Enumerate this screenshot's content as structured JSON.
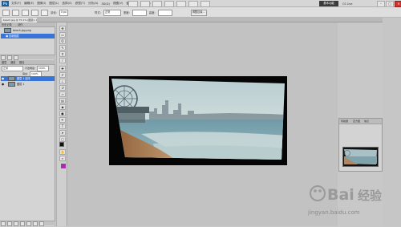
{
  "menubar": {
    "logo": "Ps",
    "items": [
      "文件(F)",
      "编辑(E)",
      "图像(I)",
      "图层(L)",
      "选择(S)",
      "滤镜(T)",
      "分析(A)",
      "3D(D)",
      "视图(V)",
      "窗口(W)",
      "帮助(H)"
    ],
    "workspace_button": "基本功能",
    "cs_live": "CS Live"
  },
  "optbar": {
    "feather_label": "羽化:",
    "feather_value": "0 px",
    "style_label": "样式:",
    "style_value": "正常",
    "width_label": "宽度:",
    "height_label": "高度:",
    "refine_button": "调整边缘..."
  },
  "document_tab": "beach.jpg @ 75.1% (图层1, RGB/8)",
  "history_panel": {
    "tabs": [
      "历史记录",
      "动作"
    ],
    "snapshot": "beach.jpg.png",
    "items": [
      "复制图层"
    ]
  },
  "layers_panel": {
    "tabs": [
      "图层",
      "通道",
      "路径"
    ],
    "blend_mode": "正常",
    "opacity_label": "不透明度:",
    "opacity_value": "100%",
    "fill_label": "填充:",
    "fill_value": "100%",
    "layers": [
      {
        "name": "图层 1 副本",
        "selected": true
      },
      {
        "name": "图层 1",
        "selected": false
      }
    ]
  },
  "navigator": {
    "tabs": [
      "导航器",
      "直方图",
      "信息"
    ]
  },
  "watermark": {
    "logo_text": "Bai经验",
    "url": "jingyan.baidu.com"
  },
  "colors": {
    "foreground": "#111111",
    "background": "#e800e8",
    "selection": "#3875d7"
  }
}
